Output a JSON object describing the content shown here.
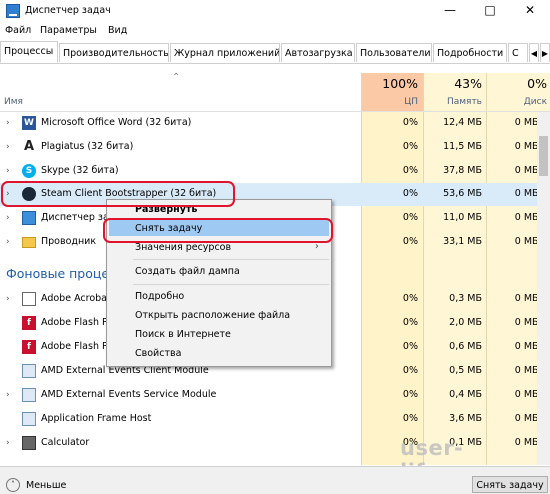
{
  "window": {
    "title": "Диспетчер задач"
  },
  "menu": [
    "Файл",
    "Параметры",
    "Вид"
  ],
  "tabs": [
    "Процессы",
    "Производительность",
    "Журнал приложений",
    "Автозагрузка",
    "Пользователи",
    "Подробности",
    "С"
  ],
  "header": {
    "name_label": "Имя",
    "cpu_pct": "100%",
    "cpu_label": "ЦП",
    "mem_pct": "43%",
    "mem_label": "Память",
    "disk_pct": "0%",
    "disk_label": "Диск"
  },
  "apps": [
    {
      "name": "Microsoft Office Word (32 бита)",
      "cpu": "0%",
      "mem": "12,4 МБ",
      "disk": "0 МБ/с",
      "icon": "word-icon"
    },
    {
      "name": "Plagiatus (32 бита)",
      "cpu": "0%",
      "mem": "11,5 МБ",
      "disk": "0 МБ/с",
      "icon": "plagiatus-icon"
    },
    {
      "name": "Skype (32 бита)",
      "cpu": "0%",
      "mem": "37,8 МБ",
      "disk": "0 МБ/с",
      "icon": "skype-icon"
    },
    {
      "name": "Steam Client Bootstrapper (32 бита)",
      "cpu": "0%",
      "mem": "53,6 МБ",
      "disk": "0 МБ/с",
      "icon": "steam-icon"
    },
    {
      "name": "Диспетчер за",
      "cpu": "0%",
      "mem": "11,0 МБ",
      "disk": "0 МБ/с",
      "icon": "task-manager-icon"
    },
    {
      "name": "Проводник",
      "cpu": "0%",
      "mem": "33,1 МБ",
      "disk": "0 МБ/с",
      "icon": "folder-icon"
    }
  ],
  "group": {
    "title": "Фоновые проце"
  },
  "bg": [
    {
      "name": "Adobe Acroba",
      "cpu": "0%",
      "mem": "0,3 МБ",
      "disk": "0 МБ/с",
      "icon": "adobe-acrobat-icon"
    },
    {
      "name": "Adobe Flash P",
      "cpu": "0%",
      "mem": "2,0 МБ",
      "disk": "0 МБ/с",
      "icon": "adobe-flash-icon"
    },
    {
      "name": "Adobe Flash P",
      "cpu": "0%",
      "mem": "0,6 МБ",
      "disk": "0 МБ/с",
      "icon": "adobe-flash-icon"
    },
    {
      "name": "AMD External Events Client Module",
      "cpu": "0%",
      "mem": "0,5 МБ",
      "disk": "0 МБ/с",
      "icon": "service-icon"
    },
    {
      "name": "AMD External Events Service Module",
      "cpu": "0%",
      "mem": "0,4 МБ",
      "disk": "0 МБ/с",
      "icon": "service-icon"
    },
    {
      "name": "Application Frame Host",
      "cpu": "0%",
      "mem": "3,6 МБ",
      "disk": "0 МБ/с",
      "icon": "service-icon"
    },
    {
      "name": "Calculator",
      "cpu": "0%",
      "mem": "0,1 МБ",
      "disk": "0 МБ/с",
      "icon": "calculator-icon"
    }
  ],
  "context_menu": [
    "Развернуть",
    "Снять задачу",
    "Значения ресурсов",
    "Создать файл дампа",
    "Подробно",
    "Открыть расположение файла",
    "Поиск в Интернете",
    "Свойства"
  ],
  "status": {
    "less": "Меньше",
    "end_task": "Снять задачу"
  },
  "watermark": "user-life.com",
  "colors": {
    "cpu_header": "#fbc9a5",
    "column_bg": "#fff3c9",
    "selection": "#d9ebf9",
    "menu_highlight": "#9ec9f2",
    "annotation": "#e0142c"
  }
}
